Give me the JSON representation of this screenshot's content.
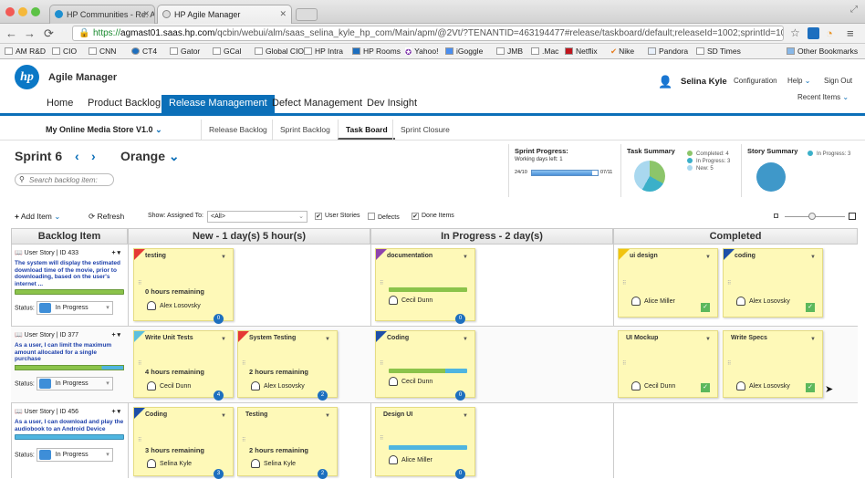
{
  "browser": {
    "tabs": [
      {
        "title": "HP Communities - Re: AGM"
      },
      {
        "title": "HP Agile Manager"
      }
    ],
    "url_scheme": "https://",
    "url_host": "agmast01.saas.hp.com",
    "url_path": "/qcbin/webui/alm/saas_selina_kyle_hp_com/Main/apm/@2Vt/?TENANTID=463194477#release/taskboard/default;releaseId=1002;sprintId=1015;teamId...",
    "bookmarks": [
      "AM R&D",
      "CIO",
      "CNN",
      "CT4",
      "Gator",
      "GCal",
      "Global CIO",
      "HP Intra",
      "HP Rooms",
      "Yahoo!",
      "iGoggle",
      "JMB",
      ".Mac",
      "Netflix",
      "Nike",
      "Pandora",
      "SD Times"
    ],
    "other_bookmarks": "Other Bookmarks"
  },
  "app": {
    "logo": "hp",
    "name": "Agile Manager",
    "nav": [
      "Home",
      "Product Backlog",
      "Release Management",
      "Defect Management",
      "Dev Insight"
    ],
    "user": "Selina Kyle",
    "links": [
      "Configuration",
      "Help",
      "Sign Out"
    ],
    "recent": "Recent Items"
  },
  "subnav": {
    "product": "My Online Media Store V1.0",
    "tabs": [
      "Release Backlog",
      "Sprint Backlog",
      "Task Board",
      "Sprint Closure"
    ]
  },
  "sprint": {
    "name": "Sprint 6",
    "release": "Orange",
    "search_placeholder": "Search backlog item:"
  },
  "progress": {
    "title": "Sprint Progress:",
    "working_days": "Working days left: 1",
    "start": "24/10",
    "end": "07/11",
    "fraction": 0.92
  },
  "task_summary": {
    "title": "Task Summary",
    "items": [
      "Completed: 4",
      "In Progress: 3",
      "New: 5"
    ]
  },
  "story_summary": {
    "title": "Story Summary",
    "items": [
      "In Progress: 3"
    ]
  },
  "toolbar": {
    "add": "Add Item",
    "refresh": "Refresh",
    "show": "Show:",
    "assigned_to": "Assigned To:",
    "assigned_value": "<All>",
    "user_stories": "User Stories",
    "defects": "Defects",
    "done_items": "Done Items"
  },
  "columns": {
    "backlog": "Backlog Item",
    "new": "New - 1 day(s) 5 hour(s)",
    "inprogress": "In Progress - 2 day(s)",
    "completed": "Completed"
  },
  "lanes": [
    {
      "head": "User Story  | ID 433",
      "text": "The system will display the estimated download time of the movie, prior to downloading, based on the user's internet ...",
      "status_label": "Status:",
      "status": "In Progress",
      "new_cards": [
        {
          "title": "testing",
          "remaining": "0 hours remaining",
          "user": "Alex Losovsky",
          "count": "0"
        }
      ],
      "prog_cards": [
        {
          "title": "documentation",
          "user": "Cecil Dunn",
          "count": "0"
        }
      ],
      "done_cards": [
        {
          "title": "ui design",
          "user": "Alice Miller"
        },
        {
          "title": "coding",
          "user": "Alex Losovsky"
        }
      ]
    },
    {
      "head": "User Story  | ID 377",
      "text": "As a user, I can limit the maximum amount allocated for a single purchase",
      "status_label": "Status:",
      "status": "In Progress",
      "new_cards": [
        {
          "title": "Write Unit Tests",
          "remaining": "4 hours remaining",
          "user": "Cecil Dunn",
          "count": "4"
        },
        {
          "title": "System Testing",
          "remaining": "2 hours remaining",
          "user": "Alex Losovsky",
          "count": "2"
        }
      ],
      "prog_cards": [
        {
          "title": "Coding",
          "user": "Cecil Dunn",
          "count": "0"
        }
      ],
      "done_cards": [
        {
          "title": "UI Mockup",
          "user": "Cecil Dunn"
        },
        {
          "title": "Write Specs",
          "user": "Alex Losovsky"
        }
      ]
    },
    {
      "head": "User Story  | ID 456",
      "text": "As a user, I can download and play the audiobook to an Android Device",
      "status_label": "Status:",
      "status": "In Progress",
      "new_cards": [
        {
          "title": "Coding",
          "remaining": "3 hours remaining",
          "user": "Selina Kyle",
          "count": "3"
        },
        {
          "title": "Testing",
          "remaining": "2 hours remaining",
          "user": "Selina Kyle",
          "count": "2"
        }
      ],
      "prog_cards": [
        {
          "title": "Design UI",
          "user": "Alice Miller",
          "count": "0"
        }
      ],
      "done_cards": []
    }
  ],
  "colors": {
    "brand": "#0b6fb8",
    "card": "#fef9b8",
    "flag_red": "#e53935",
    "flag_purple": "#8e44ad",
    "flag_blue": "#1d4fa8",
    "flag_teal": "#5bc0de",
    "flag_yellow": "#f1c40f"
  }
}
